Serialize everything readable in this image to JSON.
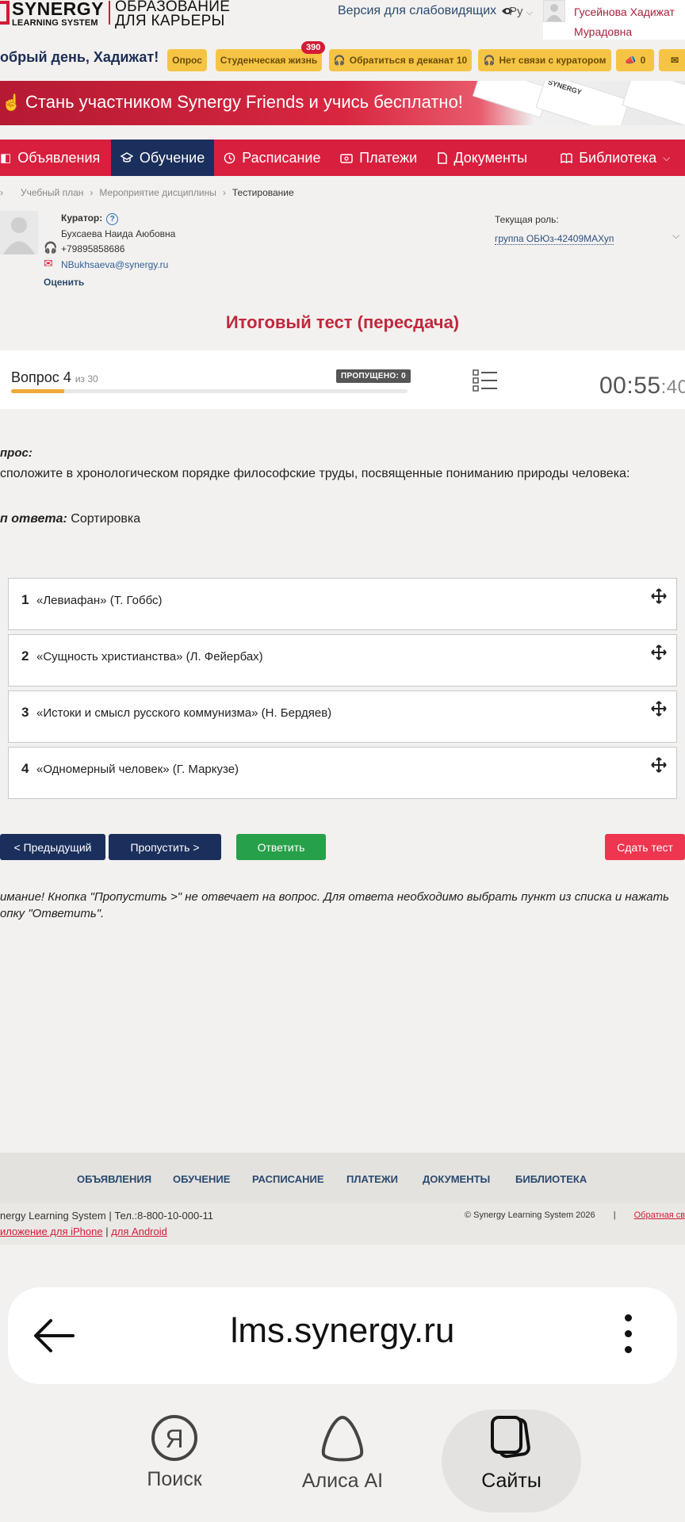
{
  "header": {
    "logo_line1": "SYNERGY",
    "logo_line2": "LEARNING SYSTEM",
    "logo_edu_1": "ОБРАЗОВАНИЕ",
    "logo_edu_2": "ДЛЯ КАРЬЕРЫ",
    "accessibility_label": "Версия для слабовидящих",
    "language": "Ру",
    "user_name": "Гусейнова Хадижат Мурадовна"
  },
  "greeting": "обрый день, Хадижат!",
  "quick_buttons": [
    {
      "label": "Опрос"
    },
    {
      "label": "Студенческая жизнь",
      "badge": "390"
    },
    {
      "label": "Обратиться в деканат 10"
    },
    {
      "label": "Нет связи с куратором"
    },
    {
      "label": "0"
    }
  ],
  "banner_text": "Стань участником Synergy Friends и учись бесплатно!",
  "banner_card_text": "SYNERGY",
  "nav": [
    {
      "label": "Объявления",
      "icon": "megaphone-icon"
    },
    {
      "label": "Обучение",
      "icon": "graduation-cap-icon",
      "active": true
    },
    {
      "label": "Расписание",
      "icon": "clock-icon"
    },
    {
      "label": "Платежи",
      "icon": "wallet-icon"
    },
    {
      "label": "Документы",
      "icon": "document-icon"
    },
    {
      "label": "Библиотека",
      "icon": "book-icon"
    }
  ],
  "breadcrumbs": [
    "Учебный план",
    "Мероприятие дисциплины",
    "Тестирование"
  ],
  "curator": {
    "title": "Куратор:",
    "name": "Бухсаева Наида Аюбовна",
    "phone": "+79895858686",
    "email": "NBukhsaeva@synergy.ru",
    "rate_label": "Оценить"
  },
  "role": {
    "label": "Текущая роль:",
    "value": "группа ОБЮз-42409МАХуп"
  },
  "test_title": "Итоговый тест (пересдача)",
  "question_panel": {
    "label": "Вопрос",
    "number": "4",
    "of_text": "из 30",
    "skipped": "ПРОПУЩЕНО: 0",
    "progress": 0.133,
    "timer_main": "00:55",
    "timer_sec": ":40"
  },
  "question": {
    "label": "прос:",
    "text": "сположите в хронологическом порядке философские труды, посвященные пониманию природы человека:",
    "type_label": "п ответа:",
    "type_value": "Сортировка"
  },
  "answers": [
    {
      "num": "1",
      "text": "«Левиафан» (Т. Гоббс)"
    },
    {
      "num": "2",
      "text": "«Сущность христианства» (Л. Фейербах)"
    },
    {
      "num": "3",
      "text": "«Истоки и смысл русского коммунизма» (Н. Бердяев)"
    },
    {
      "num": "4",
      "text": "«Одномерный человек» (Г. Маркузе)"
    }
  ],
  "buttons": {
    "prev": "< Предыдущий",
    "skip": "Пропустить >",
    "answer": "Ответить",
    "submit": "Сдать тест"
  },
  "note": "имание! Кнопка \"Пропустить >\" не отвечает на вопрос. Для ответа необходимо выбрать пункт из списка и нажать опку \"Ответить\".",
  "footer": {
    "nav": [
      "ОБЪЯВЛЕНИЯ",
      "ОБУЧЕНИЕ",
      "РАСПИСАНИЕ",
      "ПЛАТЕЖИ",
      "ДОКУМЕНТЫ",
      "БИБЛИОТЕКА"
    ],
    "company": "nergy Learning System",
    "phone": "Тел.:8-800-10-000-11",
    "iphone_link": "иложение для iPhone",
    "android_link": "для Android",
    "copyright": "© Synergy Learning System 2026",
    "feedback_link": "Обратная св"
  },
  "browser": {
    "url": "lms.synergy.ru"
  },
  "bottom_nav": [
    {
      "label": "Поиск",
      "icon": "yandex-search-icon"
    },
    {
      "label": "Алиса AI",
      "icon": "alice-icon"
    },
    {
      "label": "Сайты",
      "icon": "sites-icon",
      "active": true
    }
  ],
  "colors": {
    "brand_red": "#d81f3e",
    "navy": "#1b2f5c",
    "accent_yellow": "#f6c445",
    "answer_green": "#27a04a"
  }
}
